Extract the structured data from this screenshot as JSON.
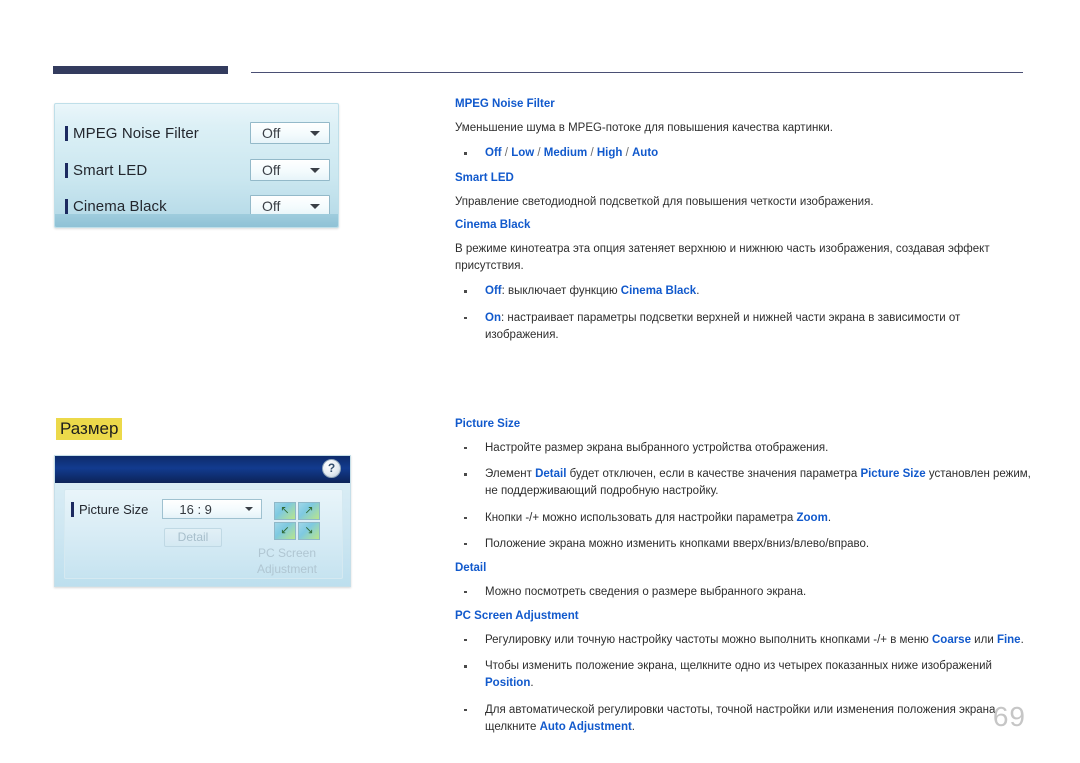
{
  "page": {
    "number": "69"
  },
  "headings": {
    "size_section": "Размер"
  },
  "widget_picture_options": {
    "rows": [
      {
        "label": "MPEG Noise Filter",
        "value": "Off"
      },
      {
        "label": "Smart LED",
        "value": "Off"
      },
      {
        "label": "Cinema Black",
        "value": "Off"
      }
    ]
  },
  "widget_picture_size": {
    "help_icon": "?",
    "row_label": "Picture Size",
    "row_value": "16 : 9",
    "detail_button": "Detail",
    "pc_screen_adjustment_label": "PC Screen Adjustment",
    "pad_arrows": [
      "↖",
      "↗",
      "↙",
      "↘"
    ]
  },
  "sections": [
    {
      "title": "MPEG Noise Filter",
      "paragraph": "Уменьшение шума в MPEG-потоке для повышения качества картинки.",
      "options_line": {
        "prefix": "",
        "options": [
          "Off",
          "Low",
          "Medium",
          "High",
          "Auto"
        ],
        "separator": " / "
      }
    },
    {
      "title": "Smart LED",
      "paragraph": "Управление светодиодной подсветкой для повышения четкости изображения."
    },
    {
      "title": "Cinema Black",
      "paragraph": "В режиме кинотеатра эта опция затеняет верхнюю и нижнюю часть изображения, создавая эффект присутствия.",
      "bullets": [
        {
          "key": "Off",
          "text_before": ": выключает функцию ",
          "emphasis": "Cinema Black",
          "text_after": "."
        },
        {
          "key": "On",
          "text_before": ": настраивает параметры подсветки верхней и нижней части экрана в зависимости от изображения.",
          "emphasis": "",
          "text_after": ""
        }
      ]
    }
  ],
  "sections_lower": [
    {
      "title": "Picture Size",
      "bullets": [
        {
          "parts": [
            {
              "t": "Настройте размер экрана выбранного устройства отображения.",
              "bold": false
            }
          ]
        },
        {
          "parts": [
            {
              "t": "Элемент ",
              "bold": false
            },
            {
              "t": "Detail",
              "bold": true
            },
            {
              "t": " будет отключен, если в качестве значения параметра ",
              "bold": false
            },
            {
              "t": "Picture Size",
              "bold": true
            },
            {
              "t": " установлен режим, не поддерживающий подробную настройку.",
              "bold": false
            }
          ]
        },
        {
          "parts": [
            {
              "t": "Кнопки -/+ можно использовать для настройки параметра ",
              "bold": false
            },
            {
              "t": "Zoom",
              "bold": true
            },
            {
              "t": ".",
              "bold": false
            }
          ]
        },
        {
          "parts": [
            {
              "t": "Положение экрана можно изменить кнопками вверх/вниз/влево/вправо.",
              "bold": false
            }
          ]
        }
      ]
    },
    {
      "title": "Detail",
      "bullets": [
        {
          "parts": [
            {
              "t": "Можно посмотреть сведения о размере выбранного экрана.",
              "bold": false
            }
          ]
        }
      ]
    },
    {
      "title": "PC Screen Adjustment",
      "bullets": [
        {
          "parts": [
            {
              "t": "Регулировку или точную настройку частоты можно выполнить кнопками -/+ в меню ",
              "bold": false
            },
            {
              "t": "Coarse",
              "bold": true
            },
            {
              "t": " или ",
              "bold": false
            },
            {
              "t": "Fine",
              "bold": true
            },
            {
              "t": ".",
              "bold": false
            }
          ]
        },
        {
          "parts": [
            {
              "t": "Чтобы изменить положение экрана, щелкните одно из четырех показанных ниже изображений ",
              "bold": false
            },
            {
              "t": "Position",
              "bold": true
            },
            {
              "t": ".",
              "bold": false
            }
          ]
        },
        {
          "parts": [
            {
              "t": "Для автоматической регулировки частоты, точной настройки или изменения положения экрана щелкните ",
              "bold": false
            },
            {
              "t": "Auto Adjustment",
              "bold": true
            },
            {
              "t": ".",
              "bold": false
            }
          ]
        }
      ]
    }
  ],
  "colors": {
    "accent_blue": "#1159cc",
    "header_navy": "#333b5e",
    "highlight_yellow": "#ecd94a",
    "page_number_gray": "#c6c6c6"
  }
}
